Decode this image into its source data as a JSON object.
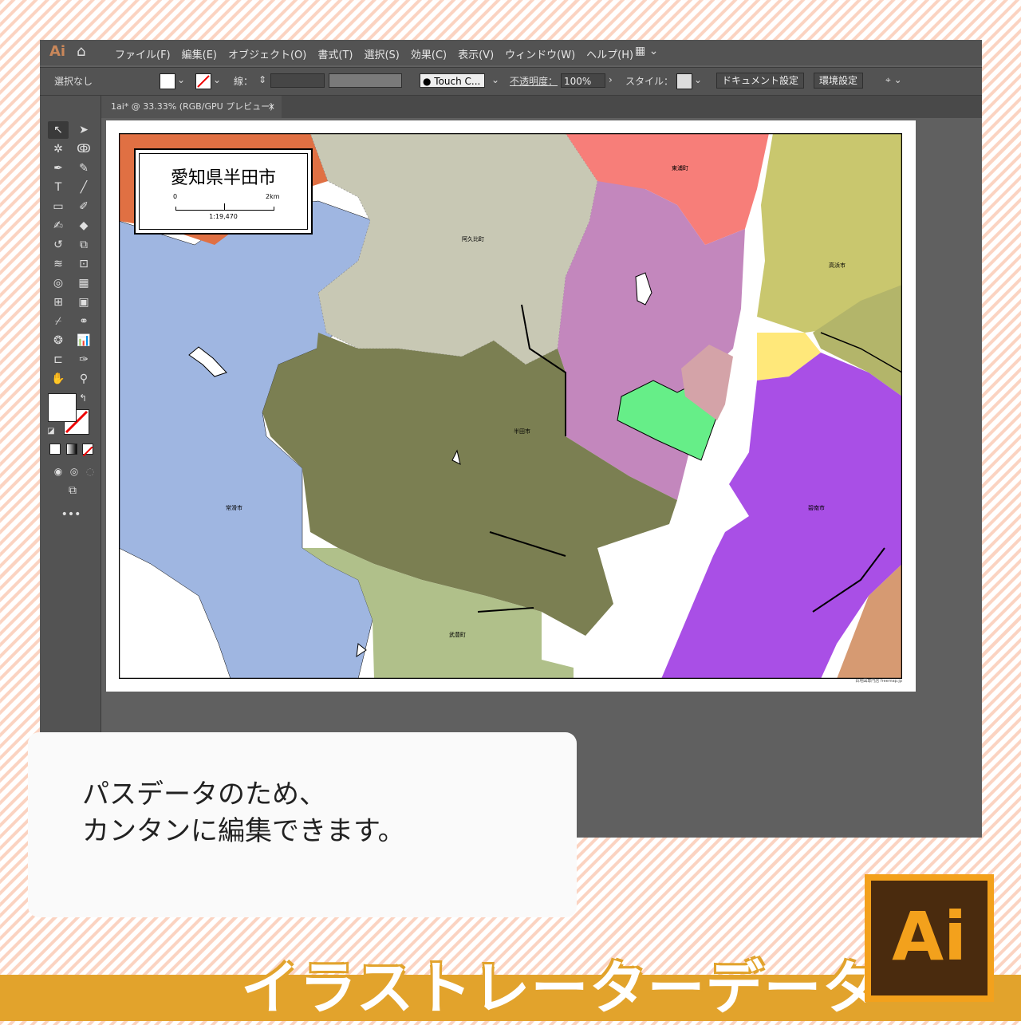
{
  "app": {
    "logo": "Ai",
    "menus": [
      "ファイル(F)",
      "編集(E)",
      "オブジェクト(O)",
      "書式(T)",
      "選択(S)",
      "効果(C)",
      "表示(V)",
      "ウィンドウ(W)",
      "ヘルプ(H)"
    ]
  },
  "control_bar": {
    "selection": "選択なし",
    "stroke_label": "線：",
    "brush": "Touch C...",
    "opacity_label": "不透明度：",
    "opacity_value": "100%",
    "style_label": "スタイル：",
    "doc_settings": "ドキュメント設定",
    "prefs": "環境設定"
  },
  "document_tab": {
    "label": "1ai* @ 33.33% (RGB/GPU プレビュー)",
    "close": "×"
  },
  "map": {
    "title": "愛知県半田市",
    "scale_start": "0",
    "scale_end": "2km",
    "scale_ratio": "1:19,470",
    "credit": "白地図専門店 freemap.jp",
    "regions": [
      {
        "name": "阿久比町",
        "color": "#c8c8b4"
      },
      {
        "name": "東浦町",
        "color": "#f77e79"
      },
      {
        "name": "高浜市",
        "color": "#c9c76e"
      },
      {
        "name": "半田市",
        "color": "#7b7f52"
      },
      {
        "name": "常滑市",
        "color": "#9fb6e1"
      },
      {
        "name": "武豊町",
        "color": "#b0c08a"
      },
      {
        "name": "碧南市",
        "color": "#a94fe6"
      }
    ],
    "other_colors": {
      "purple_pink": "#c387bd",
      "green": "#66ee88",
      "orange": "#e07043",
      "yellow": "#ffe87a",
      "tan": "#d69a72",
      "olive": "#b3b56a",
      "rose": "#d4a3a8",
      "violet": "#6a55c0"
    }
  },
  "callout": {
    "line1": "パスデータのため、",
    "line2": "カンタンに編集できます。"
  },
  "banner": {
    "text": "イラストレーターデータ"
  },
  "badge": {
    "text": "Ai"
  }
}
